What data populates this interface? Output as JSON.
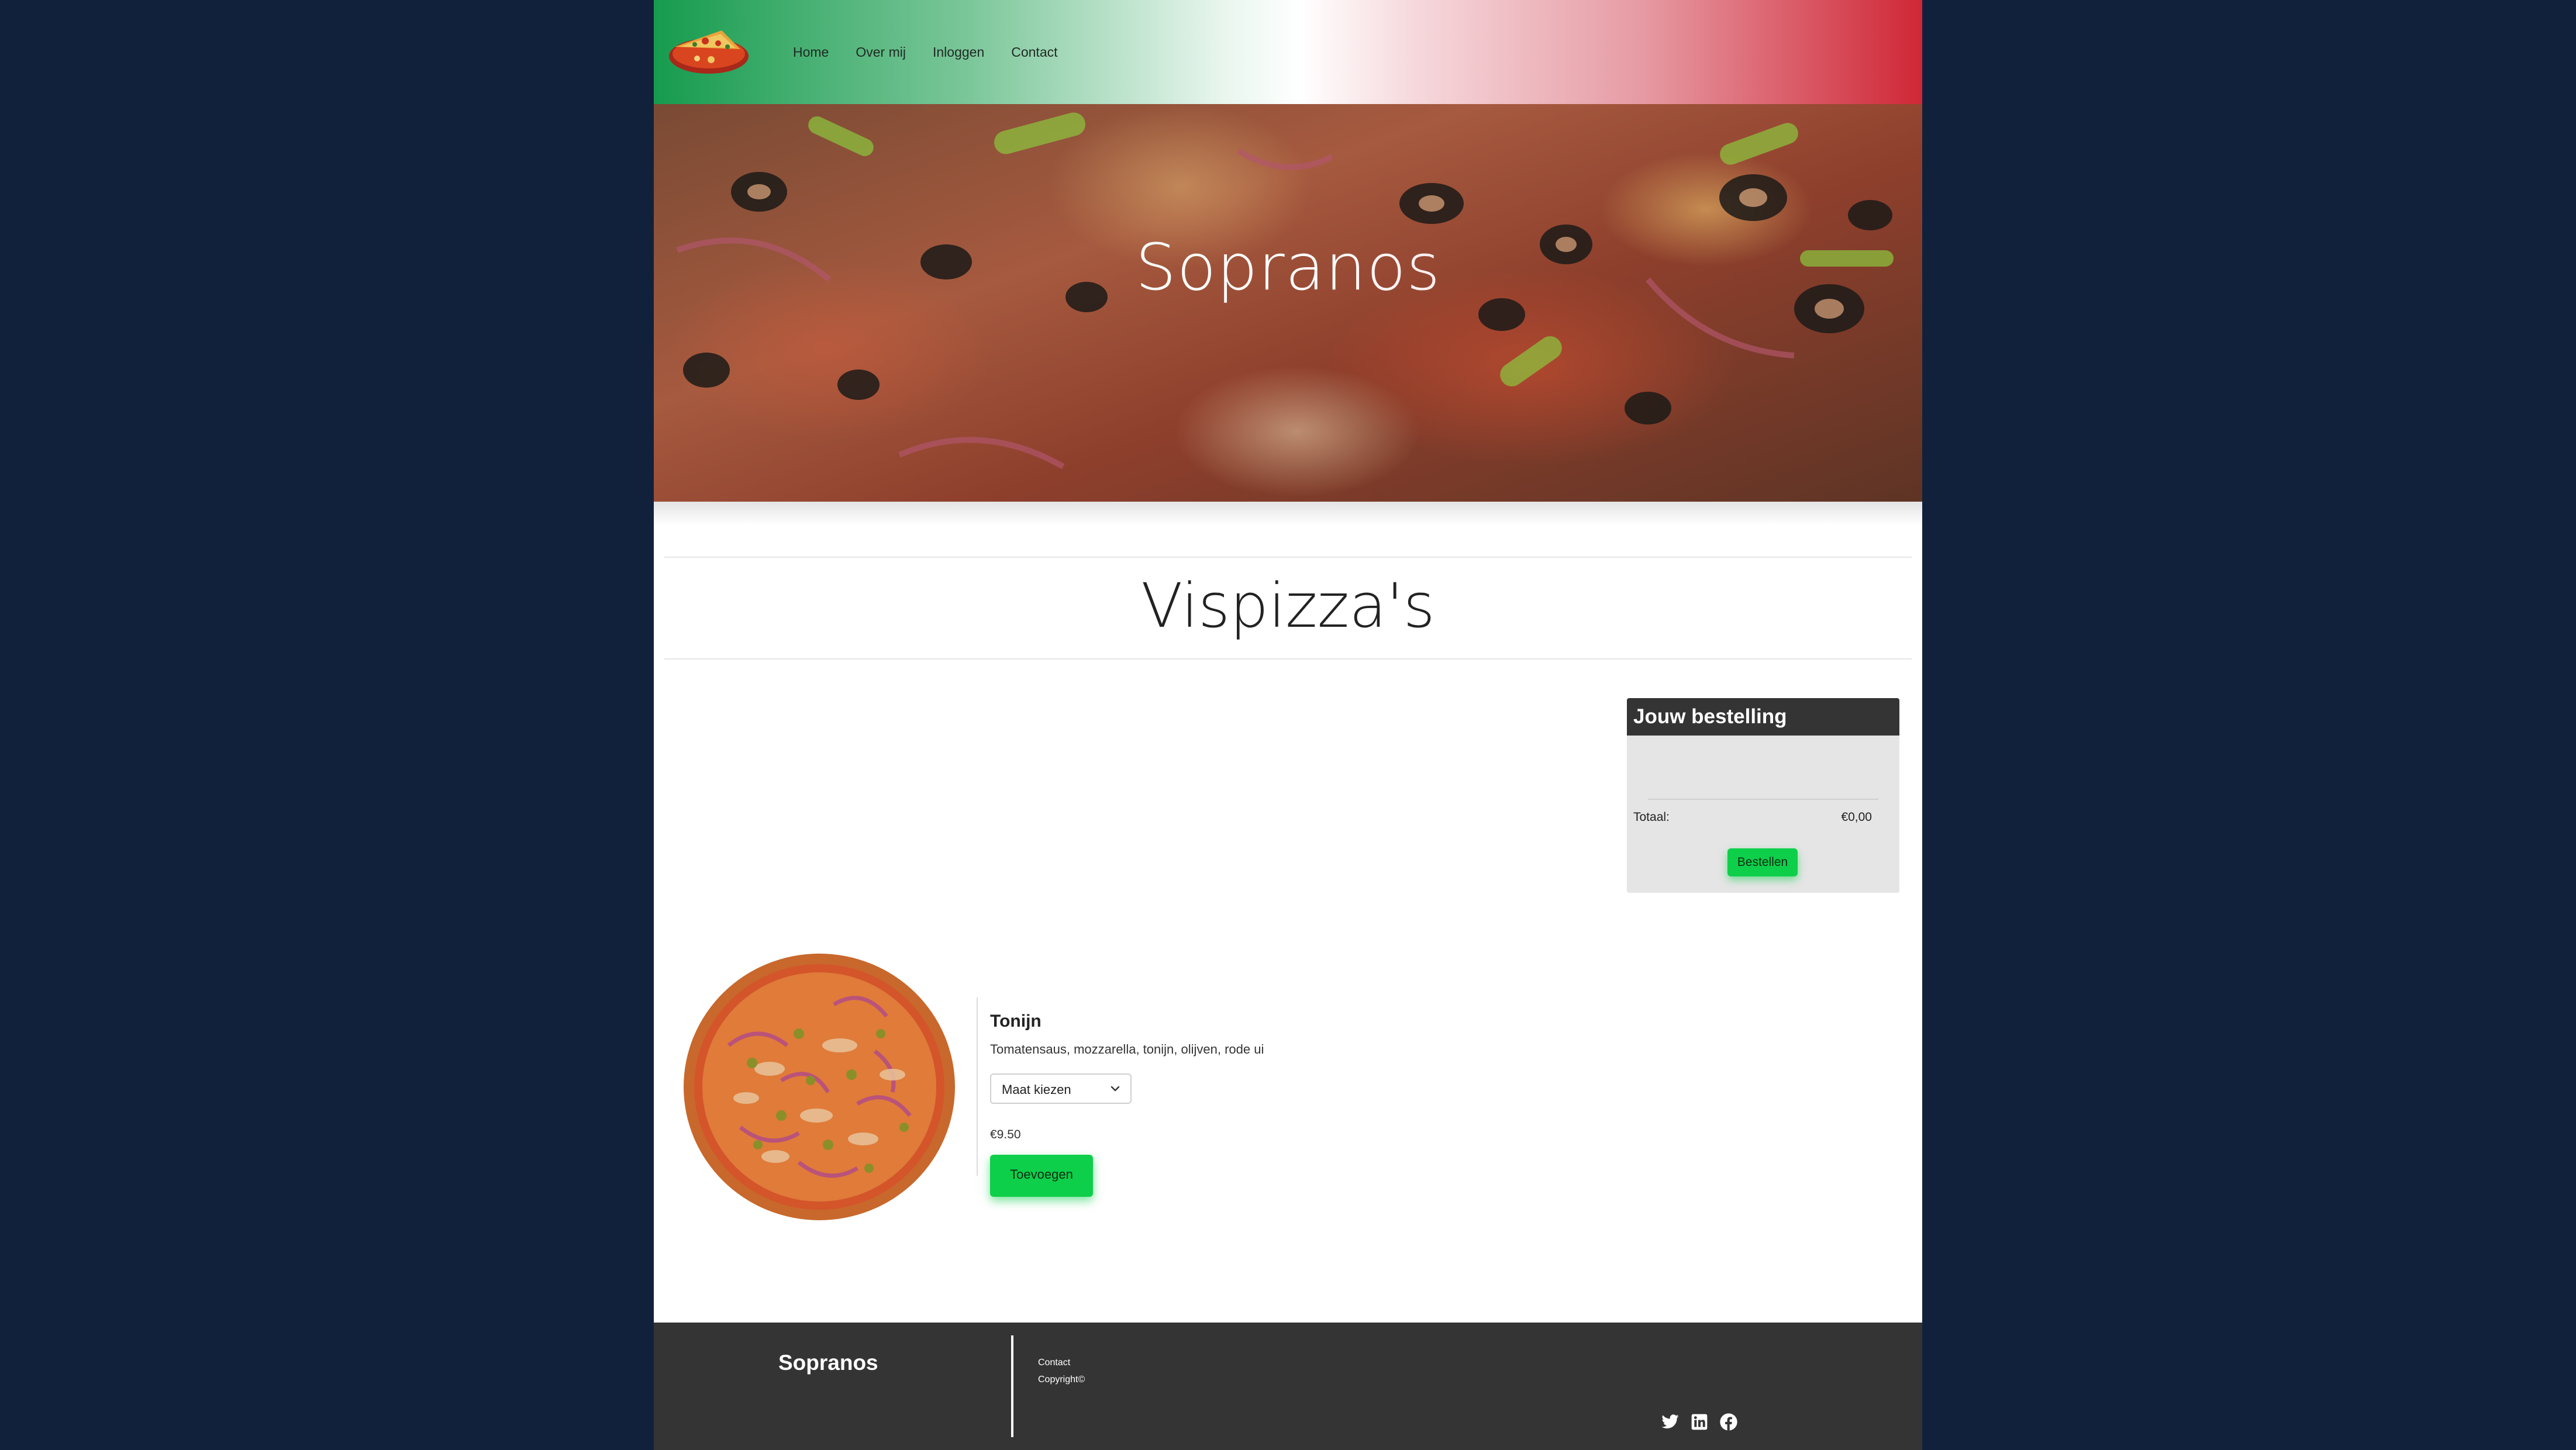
{
  "nav": {
    "items": [
      {
        "label": "Home"
      },
      {
        "label": "Over mij"
      },
      {
        "label": "Inloggen"
      },
      {
        "label": "Contact"
      }
    ]
  },
  "hero": {
    "title": "Sopranos"
  },
  "section": {
    "title": "Vispizza's"
  },
  "order": {
    "title": "Jouw bestelling",
    "total_label": "Totaal:",
    "total_value": "€0,00",
    "order_button": "Bestellen"
  },
  "product": {
    "name": "Tonijn",
    "description": "Tomatensaus, mozzarella, tonijn, olijven, rode ui",
    "size_select": "Maat kiezen",
    "price": "€9.50",
    "add_button": "Toevoegen"
  },
  "footer": {
    "brand": "Sopranos",
    "links": [
      {
        "label": "Contact"
      },
      {
        "label": "Copyright©"
      }
    ],
    "socials": [
      "twitter-icon",
      "linkedin-icon",
      "facebook-icon"
    ]
  },
  "colors": {
    "background": "#12213b",
    "green_accent": "#0ecf4a",
    "header_green": "#169b4e",
    "header_red": "#d02736",
    "dark_panel": "#343434"
  }
}
